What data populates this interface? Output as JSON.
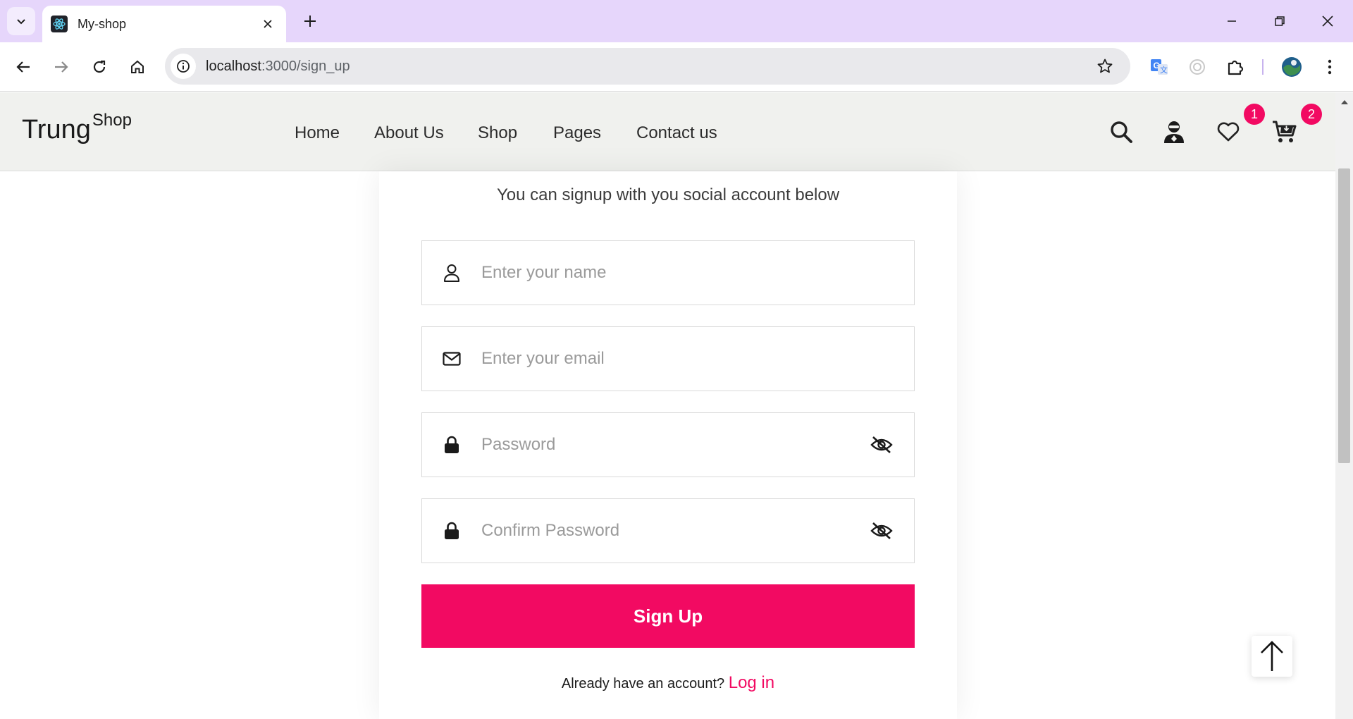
{
  "browser": {
    "tab_title": "My-shop",
    "url_host": "localhost",
    "url_path": ":3000/sign_up"
  },
  "site": {
    "logo_main": "Trung",
    "logo_sup": "Shop",
    "menu": [
      "Home",
      "About Us",
      "Shop",
      "Pages",
      "Contact us"
    ],
    "wishlist_count": "1",
    "cart_count": "2"
  },
  "form": {
    "subtitle": "You can signup with you social account below",
    "name_placeholder": "Enter your name",
    "email_placeholder": "Enter your email",
    "password_placeholder": "Password",
    "confirm_placeholder": "Confirm Password",
    "submit_label": "Sign Up",
    "login_prompt": "Already have an account?",
    "login_link": "Log in"
  },
  "colors": {
    "accent": "#f20a62",
    "tabstrip": "#e6d6fb",
    "header_bg": "#f0f1ee"
  }
}
